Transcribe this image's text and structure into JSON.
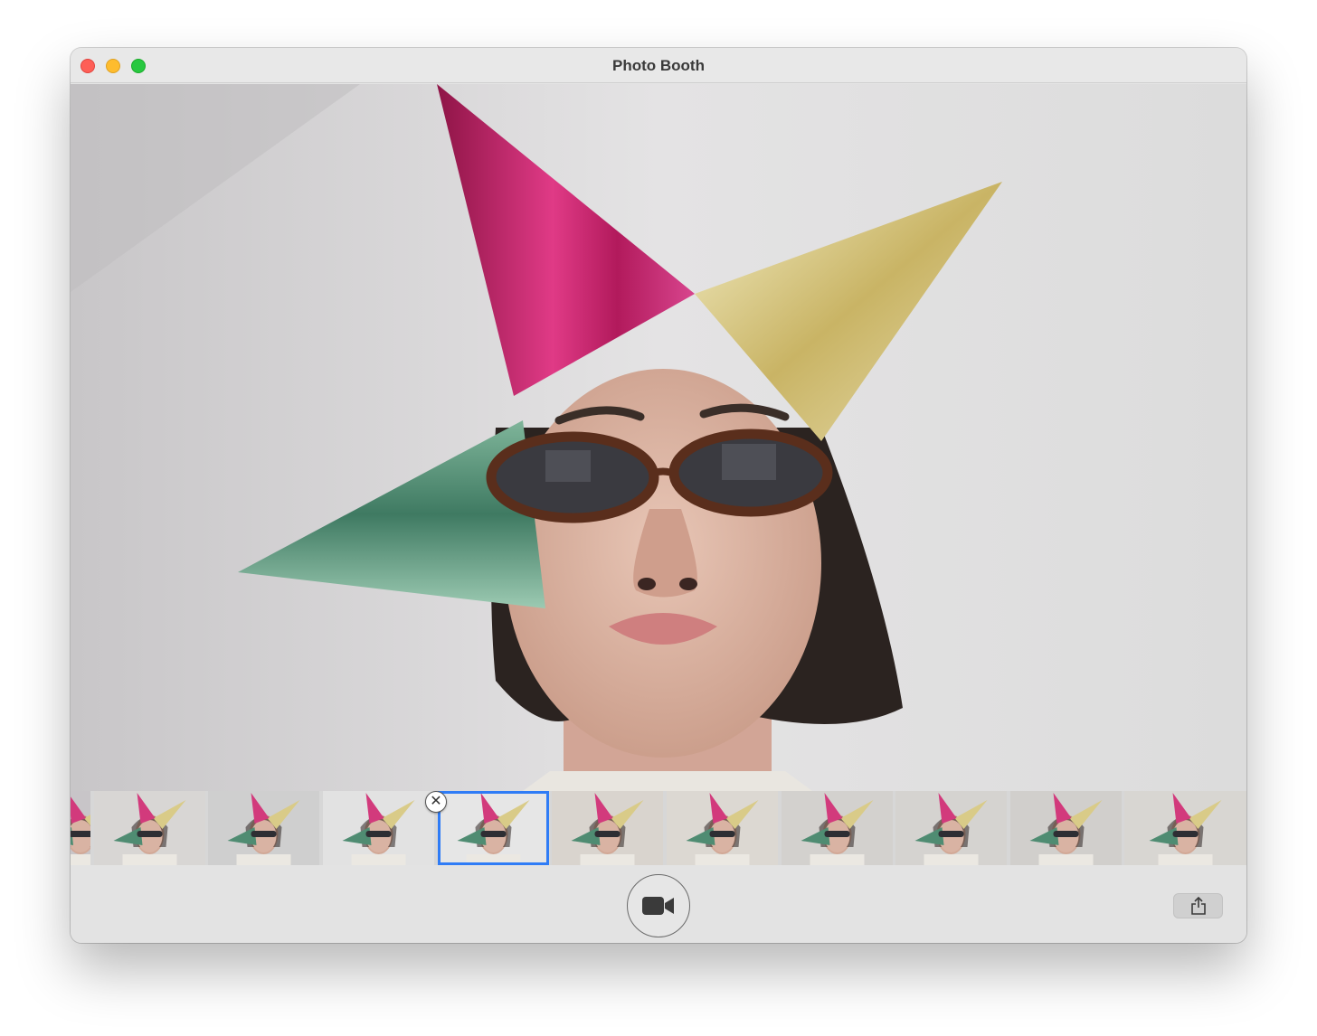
{
  "window": {
    "title": "Photo Booth"
  },
  "photo": {
    "subject": "person-wearing-party-hats-and-sunglasses"
  },
  "filmstrip": {
    "selected_index": 4,
    "thumbnail_count": 11
  },
  "toolbar": {
    "record_icon": "video-camera-icon",
    "share_icon": "share-icon"
  },
  "colors": {
    "selection": "#2f7cf6",
    "close": "#fe5f57",
    "minimize": "#febc2e",
    "zoom": "#28c840"
  }
}
